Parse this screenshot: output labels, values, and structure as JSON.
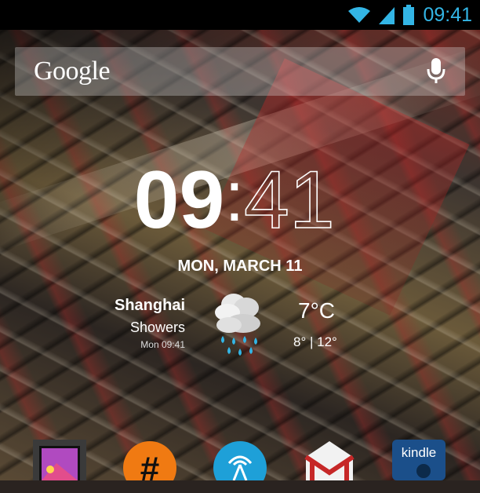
{
  "status_bar": {
    "time": "09:41",
    "icons": [
      "wifi-icon",
      "signal-icon",
      "battery-icon"
    ],
    "accent_color": "#33b5e5"
  },
  "search": {
    "logo": "Google",
    "mic_icon": "microphone-icon"
  },
  "clock": {
    "hours": "09",
    "separator": ":",
    "minutes": "41",
    "date": "MON, MARCH 11"
  },
  "weather": {
    "city": "Shanghai",
    "condition": "Showers",
    "updated": "Mon 09:41",
    "temperature": "7°C",
    "range": "8° | 12°",
    "icon": "cloud-rain-icon"
  },
  "dock": {
    "apps": [
      {
        "name": "gallery-app-icon"
      },
      {
        "name": "hashtag-app-icon"
      },
      {
        "name": "broadcast-app-icon"
      },
      {
        "name": "gmail-app-icon"
      },
      {
        "name": "kindle-app-icon",
        "label": "kindle"
      }
    ]
  }
}
